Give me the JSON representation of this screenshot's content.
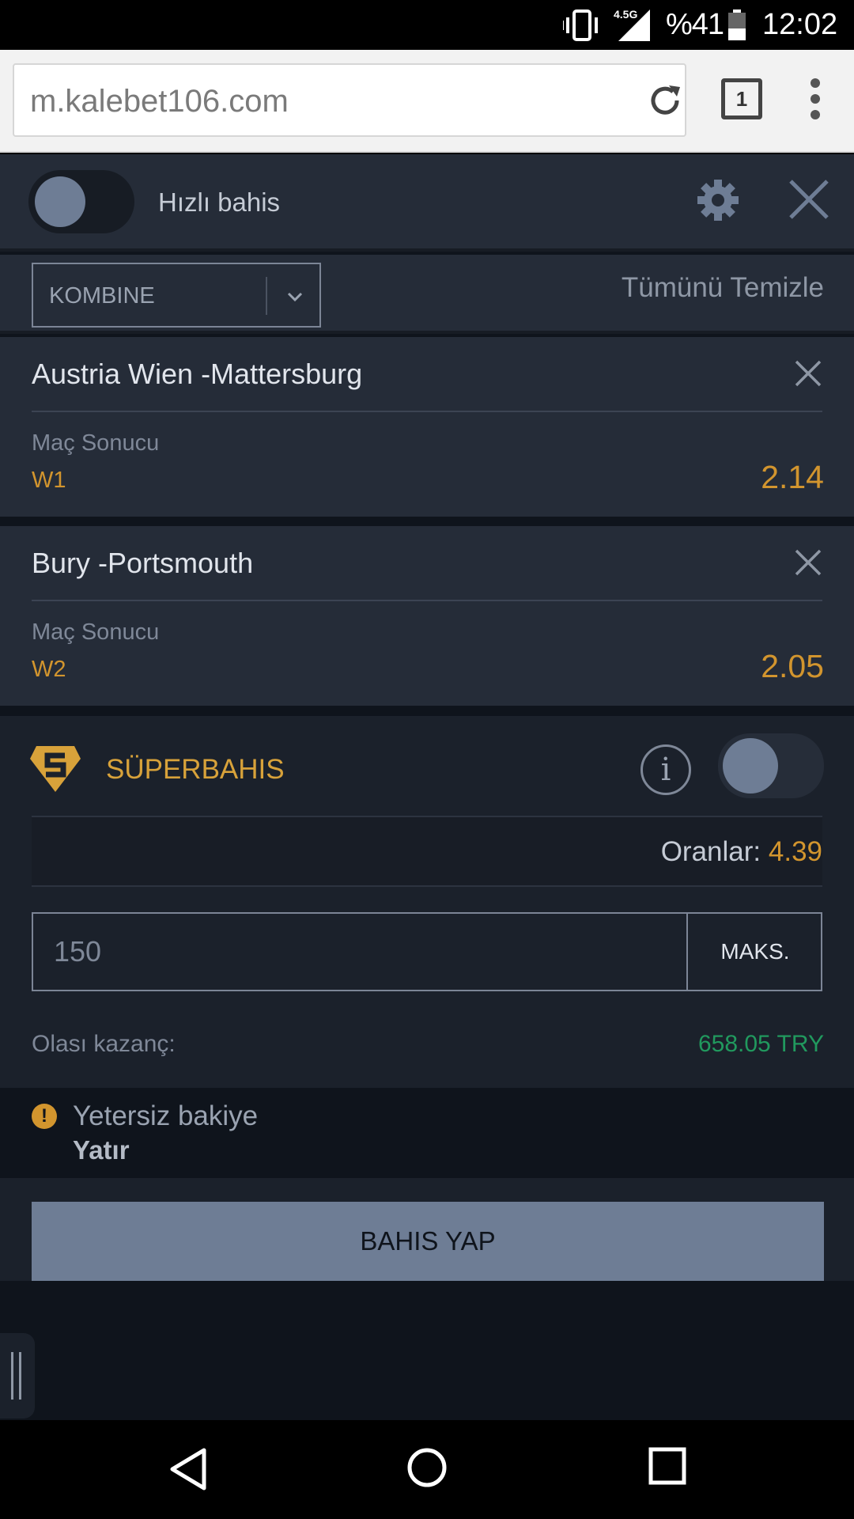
{
  "status_bar": {
    "network": "4.5G",
    "battery_text": "%41",
    "time": "12:02",
    "icons": [
      "vibrate-icon",
      "signal-icon",
      "battery-icon"
    ]
  },
  "browser": {
    "url": "m.kalebet106.com",
    "tab_count": "1"
  },
  "betslip": {
    "quick_bet_label": "Hızlı bahis",
    "quick_bet_on": false,
    "bet_type": "KOMBINE",
    "clear_all": "Tümünü Temizle",
    "bets": [
      {
        "match": "Austria Wien -Mattersburg",
        "market": "Maç Sonucu",
        "pick": "W1",
        "odd": "2.14"
      },
      {
        "match": "Bury -Portsmouth",
        "market": "Maç Sonucu",
        "pick": "W2",
        "odd": "2.05"
      }
    ],
    "superbet": {
      "label": "SÜPERBAHIS",
      "on": false
    },
    "odds_label": "Oranlar:",
    "odds_value": "4.39",
    "stake_value": "150",
    "max_label": "MAKS.",
    "possible_win_label": "Olası kazanç:",
    "possible_win_value": "658.05 TRY",
    "warning_text": "Yetersiz bakiye",
    "deposit_link": "Yatır",
    "place_bet": "BAHIS YAP"
  },
  "colors": {
    "accent": "#d2952e",
    "win": "#21995e",
    "panel": "#252c38",
    "bg": "#0f141c",
    "button": "#6e7d95"
  }
}
